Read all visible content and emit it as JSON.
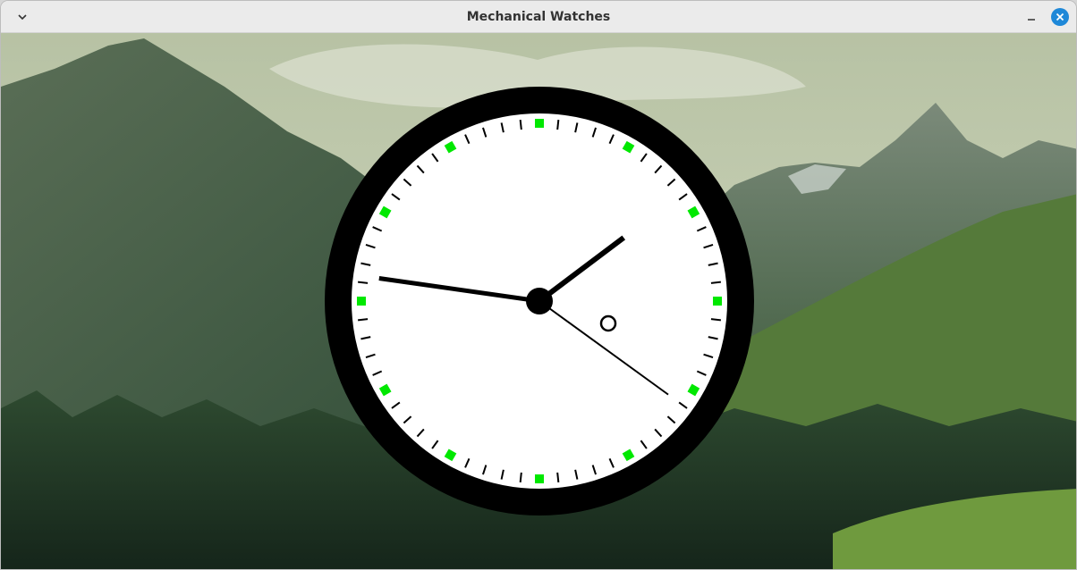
{
  "window": {
    "title": "Mechanical Watches",
    "menu_icon": "chevron-down-icon",
    "minimize_icon": "minimize-icon",
    "close_icon": "close-icon",
    "close_color": "#1e88d8"
  },
  "background": {
    "scene": "mountain-forest-landscape",
    "sky_color": "#c9d3b4",
    "mountain_color": "#3e5a3e",
    "forest_color": "#1f3522",
    "meadow_color": "#6f9a3e"
  },
  "clock": {
    "bezel_color": "#000000",
    "face_color": "#ffffff",
    "hour_marker_color": "#00e800",
    "minute_tick_color": "#000000",
    "hand_color": "#000000",
    "time": {
      "hours": 1,
      "minutes": 46,
      "seconds": 21
    },
    "subdial": "small-ring"
  }
}
